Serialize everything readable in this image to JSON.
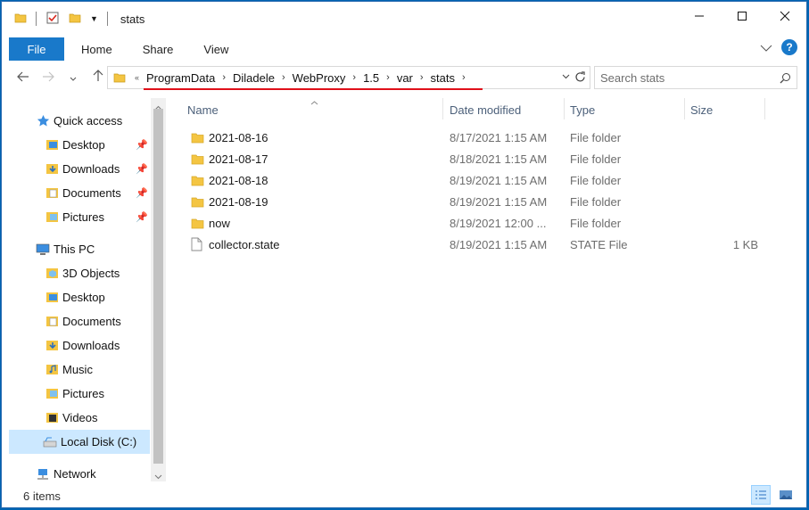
{
  "window": {
    "title": "stats"
  },
  "ribbon": {
    "tabs": [
      "File",
      "Home",
      "Share",
      "View"
    ]
  },
  "breadcrumb": {
    "overflow": "«",
    "items": [
      "ProgramData",
      "Diladele",
      "WebProxy",
      "1.5",
      "var",
      "stats"
    ]
  },
  "search": {
    "placeholder": "Search stats"
  },
  "navpane": {
    "quick_access": "Quick access",
    "quick_items": [
      "Desktop",
      "Downloads",
      "Documents",
      "Pictures"
    ],
    "this_pc": "This PC",
    "pc_items": [
      "3D Objects",
      "Desktop",
      "Documents",
      "Downloads",
      "Music",
      "Pictures",
      "Videos",
      "Local Disk (C:)"
    ],
    "network": "Network"
  },
  "columns": {
    "name": "Name",
    "date": "Date modified",
    "type": "Type",
    "size": "Size"
  },
  "files": [
    {
      "name": "2021-08-16",
      "date": "8/17/2021 1:15 AM",
      "type": "File folder",
      "size": "",
      "icon": "folder-icon"
    },
    {
      "name": "2021-08-17",
      "date": "8/18/2021 1:15 AM",
      "type": "File folder",
      "size": "",
      "icon": "folder-icon"
    },
    {
      "name": "2021-08-18",
      "date": "8/19/2021 1:15 AM",
      "type": "File folder",
      "size": "",
      "icon": "folder-icon"
    },
    {
      "name": "2021-08-19",
      "date": "8/19/2021 1:15 AM",
      "type": "File folder",
      "size": "",
      "icon": "folder-icon"
    },
    {
      "name": "now",
      "date": "8/19/2021 12:00 ...",
      "type": "File folder",
      "size": "",
      "icon": "folder-icon"
    },
    {
      "name": "collector.state",
      "date": "8/19/2021 1:15 AM",
      "type": "STATE File",
      "size": "1 KB",
      "icon": "file-icon"
    }
  ],
  "status": {
    "item_count": "6 items"
  },
  "colors": {
    "accent": "#1979ca",
    "selection": "#cce8ff",
    "folder": "#f4c542",
    "highlight_underline": "#e0101a"
  }
}
